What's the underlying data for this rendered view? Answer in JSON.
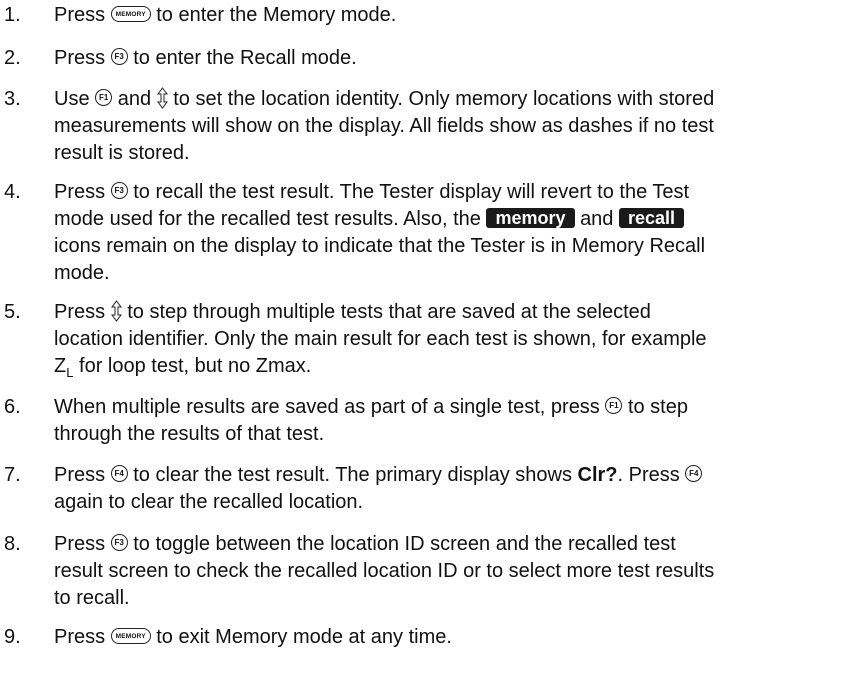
{
  "keys": {
    "memory": "MEMORY",
    "f1": "F1",
    "f3": "F3",
    "f4": "F4"
  },
  "icons": {
    "memory_tag": "memory",
    "recall_tag": "recall"
  },
  "steps": [
    {
      "num": "1.",
      "t1": "Press",
      "t2": "to enter the Memory mode."
    },
    {
      "num": "2.",
      "t1": "Press",
      "t2": "to enter the Recall mode."
    },
    {
      "num": "3.",
      "t1": "Use",
      "t2": "and",
      "t3": "to set the location identity. Only memory locations with stored",
      "line2": "measurements will show on the display. All fields show as dashes if no test",
      "line3": "result is stored."
    },
    {
      "num": "4.",
      "t1": "Press",
      "t2": "to recall the test result. The Tester display will revert to the Test",
      "line2a": "mode used for the recalled test results. Also, the",
      "line2b": "and",
      "line3": "icons remain on the display to indicate that the Tester is in Memory Recall",
      "line4": "mode."
    },
    {
      "num": "5.",
      "t1": "Press",
      "t2": "to step through multiple tests that are saved at the selected",
      "line2": "location identifier. Only the main result for each test is shown, for example",
      "line3a": "Z",
      "line3sub": "L",
      "line3b": "for loop test, but no Zmax."
    },
    {
      "num": "6.",
      "t1": "When multiple results are saved as part of a single test, press",
      "t2": "to step",
      "line2": "through the results of that test."
    },
    {
      "num": "7.",
      "t1": "Press",
      "t2": "to clear the test result. The primary display shows",
      "bold": "Clr?",
      "t3": ". Press",
      "line2": "again to clear the recalled location."
    },
    {
      "num": "8.",
      "t1": "Press",
      "t2": "to toggle between the location ID screen and the recalled test",
      "line2": "result screen to check the recalled location ID or to select more test results",
      "line3": "to recall."
    },
    {
      "num": "9.",
      "t1": "Press",
      "t2": "to exit Memory mode at any time."
    }
  ]
}
